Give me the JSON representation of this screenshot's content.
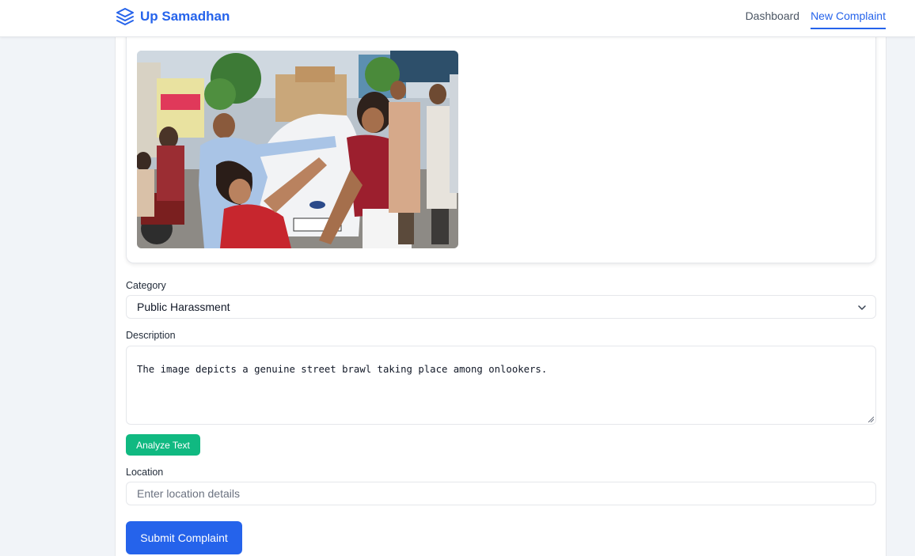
{
  "brand": {
    "name": "Up Samadhan",
    "icon": "layers-icon",
    "color": "#2563eb"
  },
  "nav": {
    "links": [
      {
        "label": "Dashboard",
        "active": false
      },
      {
        "label": "New Complaint",
        "active": true
      }
    ]
  },
  "form": {
    "category": {
      "label": "Category",
      "value": "Public Harassment"
    },
    "description": {
      "label": "Description",
      "value": "The image depicts a genuine street brawl taking place among onlookers."
    },
    "analyze_label": "Analyze Text",
    "location": {
      "label": "Location",
      "placeholder": "Enter location details"
    },
    "submit_label": "Submit Complaint"
  },
  "colors": {
    "primary": "#2563eb",
    "success": "#10b981",
    "background": "#f1f4f8"
  }
}
